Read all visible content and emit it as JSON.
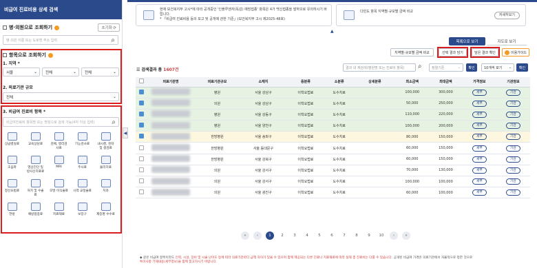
{
  "sidebar": {
    "title": "비급여 진료비용 상세 검색",
    "hospital_section": {
      "title": "병·의원으로 조회하기",
      "reset_label": "초기화",
      "search_placeholder": "병·의원 이름 또는 도로명 주소 입력"
    },
    "item_section": {
      "title": "항목으로 조회하기",
      "region_label": "1. 지역 *",
      "region_selects": [
        "서울",
        "전체",
        "전체"
      ],
      "size_label": "2. 의료기관 규모",
      "size_select": "전체",
      "treatment_label": "3. 비급여 진료비 항목 *",
      "treatment_placeholder": "비급여진료비 항목명 또는 명칭으로 검색 가능(4자 이상 입력)",
      "icons": [
        {
          "label": "상급병실료",
          "icon": "bed-icon"
        },
        {
          "label": "교육상담료",
          "icon": "consult-icon"
        },
        {
          "label": "검체, 병리검사료",
          "icon": "test-icon"
        },
        {
          "label": "기능검사료",
          "icon": "function-icon"
        },
        {
          "label": "내시경, 천자및 생검료",
          "icon": "endoscope-icon"
        },
        {
          "label": "초음파",
          "icon": "ultrasound-icon"
        },
        {
          "label": "영상진단 및 방사선치료료",
          "icon": "radiology-icon"
        },
        {
          "label": "MRI",
          "icon": "mri-icon"
        },
        {
          "label": "주사료",
          "icon": "injection-icon"
        },
        {
          "label": "물리치료",
          "icon": "therapy-icon"
        },
        {
          "label": "정신요법료",
          "icon": "mental-icon"
        },
        {
          "label": "처치 및 수술료",
          "icon": "surgery-icon"
        },
        {
          "label": "모발 이식술료",
          "icon": "hair-icon"
        },
        {
          "label": "시력 교정술료",
          "icon": "eye-icon"
        },
        {
          "label": "치과",
          "icon": "tooth-icon"
        },
        {
          "label": "한방",
          "icon": "herb-icon"
        },
        {
          "label": "예방접종료",
          "icon": "vaccine-icon"
        },
        {
          "label": "치료재료",
          "icon": "material-icon"
        },
        {
          "label": "보장구",
          "icon": "aid-icon"
        },
        {
          "label": "제증명 수수료",
          "icon": "certificate-icon"
        }
      ]
    }
  },
  "notices": {
    "left_text": "현재 보건복지부 고시*에 따라 공개중인 '인플루엔자(독감) 예방접종' 항목은 4가 백신접종을 말하므로 유의하시기 바랍니다.",
    "left_sub": "* 「비급여 진료비용 등의 보고 및 공개에 관한 기준」(보건복지부 고시 제2025-48호)",
    "right_text": "다빈도 항목 지역별·규모별 금액 비교",
    "detail_button": "자세히보기"
  },
  "view_tabs": {
    "list": "목록으로 보기",
    "map": "지도로 보기"
  },
  "toolbar": {
    "compare_label": "지역별·규모별 금액 비교",
    "compare_selected": "선택 결과 담기",
    "cart_view": "담은 결과 확인",
    "guide": "이용가이드"
  },
  "result": {
    "label_prefix": "검색결과 총",
    "count": "1607건",
    "search_placeholder": "결과 내 재검색(병원명 또는 진료비 항목)",
    "sort_placeholder": "정렬기준",
    "confirm": "확인",
    "per_page": "10개씩 보기",
    "confirm2": "확인"
  },
  "table": {
    "columns": [
      "의료기관명",
      "의료기관규모",
      "소재지",
      "중분류",
      "소분류",
      "상세분류",
      "최소금액",
      "최대금액",
      "가격정보",
      "기관정보"
    ],
    "rows": [
      {
        "size": "병원",
        "loc": "서울 강남구",
        "mid": "이학요법료",
        "sub": "도수치료",
        "min": "100,000",
        "max": "300,000",
        "checked": true,
        "style": "hl"
      },
      {
        "size": "의원",
        "loc": "서울 강남구",
        "mid": "이학요법료",
        "sub": "도수치료",
        "min": "50,000",
        "max": "250,000",
        "checked": true,
        "style": "hl"
      },
      {
        "size": "병원",
        "loc": "서울 강동구",
        "mid": "이학요법료",
        "sub": "도수치료",
        "min": "110,000",
        "max": "220,000",
        "checked": true,
        "style": "hl"
      },
      {
        "size": "병원",
        "loc": "서울 양천구",
        "mid": "이학요법료",
        "sub": "도수치료",
        "min": "100,000",
        "max": "200,000",
        "checked": true,
        "style": "hl"
      },
      {
        "size": "한방병원",
        "loc": "서울 송파구",
        "mid": "이학요법료",
        "sub": "도수치료",
        "min": "80,000",
        "max": "150,000",
        "checked": true,
        "style": "hl-y"
      },
      {
        "size": "한방병원",
        "loc": "서울 동대문구",
        "mid": "이학요법료",
        "sub": "도수치료",
        "min": "60,000",
        "max": "150,000",
        "checked": false,
        "style": ""
      },
      {
        "size": "한방병원",
        "loc": "서울 강북구",
        "mid": "이학요법료",
        "sub": "도수치료",
        "min": "60,000",
        "max": "150,000",
        "checked": false,
        "style": ""
      },
      {
        "size": "의원",
        "loc": "서울 강서구",
        "mid": "이학요법료",
        "sub": "도수치료",
        "min": "70,000",
        "max": "130,000",
        "checked": false,
        "style": ""
      },
      {
        "size": "의원",
        "loc": "서울 강서구",
        "mid": "이학요법료",
        "sub": "도수치료",
        "min": "100,000",
        "max": "100,000",
        "checked": false,
        "style": ""
      },
      {
        "size": "의원",
        "loc": "서울 광진구",
        "mid": "이학요법료",
        "sub": "도수치료",
        "min": "60,000",
        "max": "100,000",
        "checked": false,
        "style": ""
      }
    ],
    "price_btn": "세부",
    "inst_btn": "기관"
  },
  "pagination": {
    "pages": [
      "1",
      "2",
      "3",
      "4",
      "5",
      "6",
      "7",
      "8",
      "9",
      "10"
    ],
    "current": "1"
  },
  "footer": {
    "line1_a": "◆ 같은 비급여 항목이라도 ",
    "line1_red": "인력, 시설, 장비 및 시술 난이도 등에 따라 의료기관마다 금액 차이가 있을 수 있으며 함께 제공되는 다른 진료나 치료재료에 따라 실제 총 진료비는 다를 수 있습니다.",
    "line1_b": " 공개된 비급여 가격은 의료기관에서 자율적으로 정한 것으로",
    "line2_red": "특이사항 기재내용(세부정보)을 함께 참고하시기 바랍니다."
  },
  "colors": {
    "primary": "#2b4a8b",
    "highlight_red": "#d91c1c",
    "row_green": "#e6f3e2"
  }
}
